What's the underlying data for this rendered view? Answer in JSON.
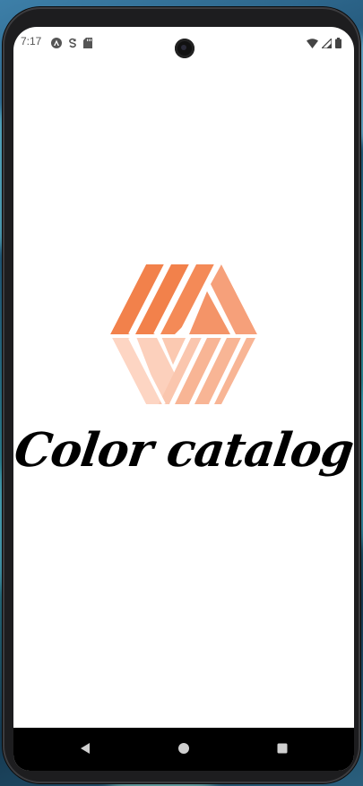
{
  "status_bar": {
    "time": "7:17",
    "left_icons": [
      "android-auto-icon",
      "sync-icon",
      "sd-card-icon"
    ],
    "right_icons": [
      "wifi-icon",
      "cell-signal-icon",
      "battery-icon"
    ]
  },
  "splash": {
    "title": "Color catalog",
    "logo_icon": "hexagon-stripes-logo",
    "logo_colors": {
      "dark": "#f2814b",
      "medium": "#f6a07a",
      "light": "#fac6ae",
      "lightest": "#fdd5c3"
    }
  },
  "nav_bar": {
    "buttons": [
      "back-icon",
      "home-icon",
      "recents-icon"
    ]
  }
}
